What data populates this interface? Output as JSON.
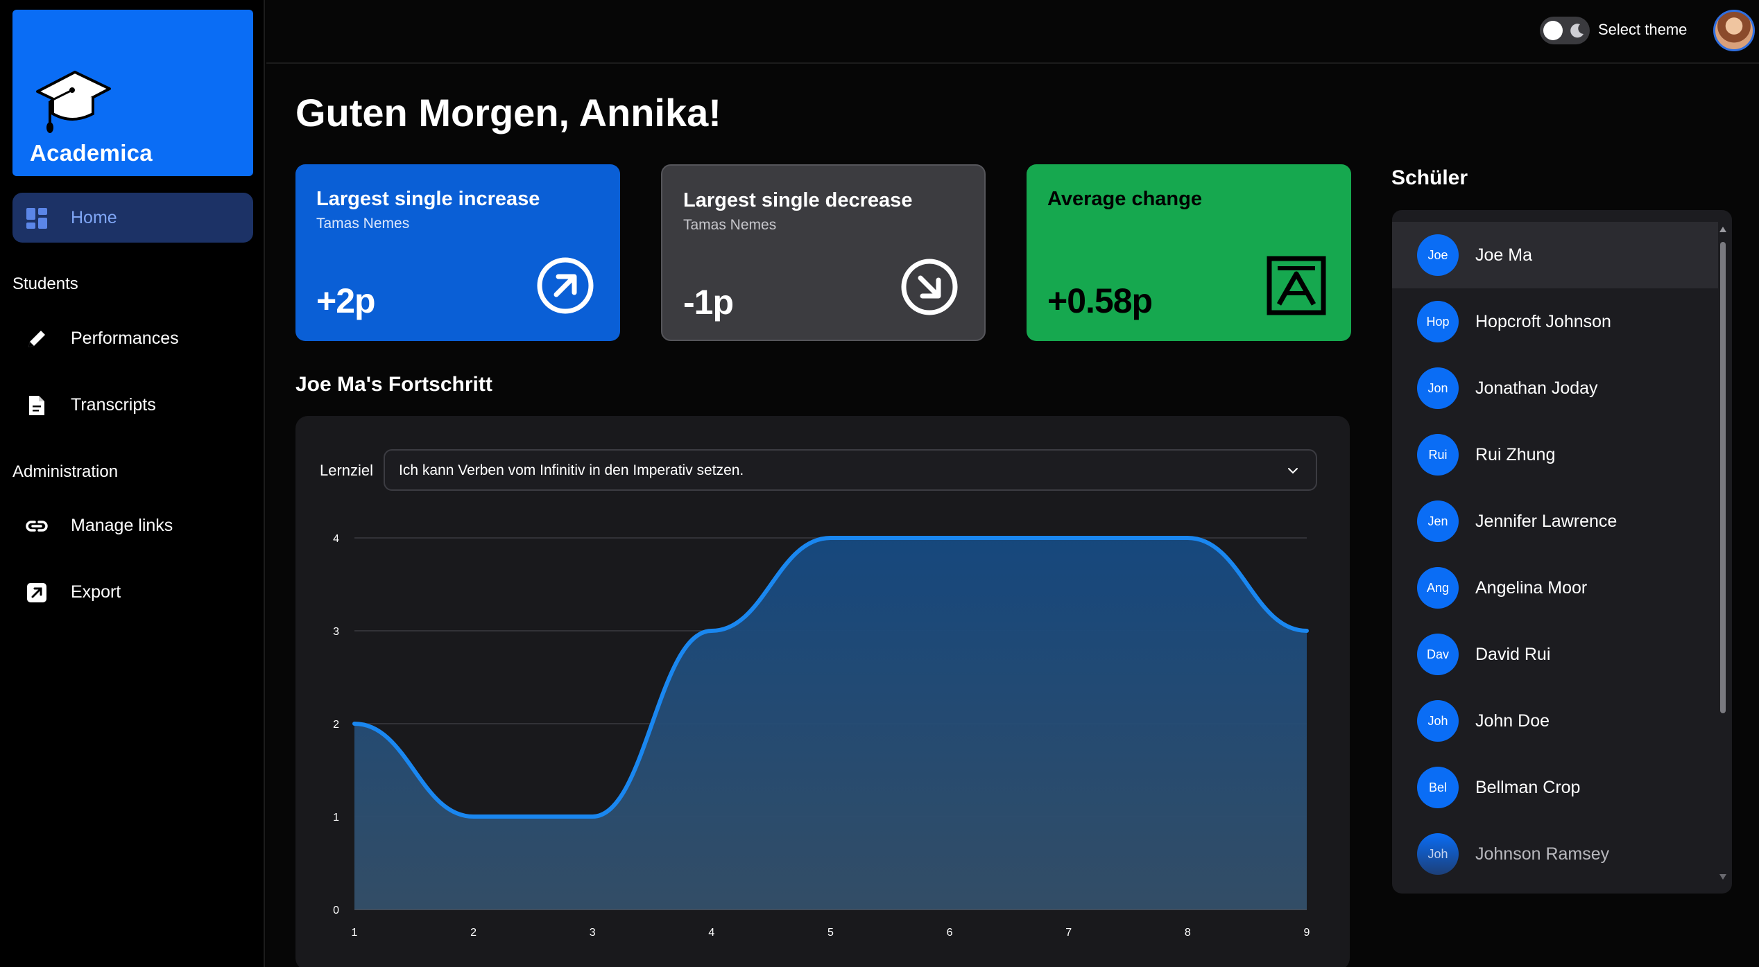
{
  "app": {
    "name": "Academica"
  },
  "sidebar": {
    "home": {
      "label": "Home"
    },
    "sections": [
      {
        "label": "Students",
        "items": [
          {
            "label": "Performances",
            "icon": "pencil-icon"
          },
          {
            "label": "Transcripts",
            "icon": "document-icon"
          }
        ]
      },
      {
        "label": "Administration",
        "items": [
          {
            "label": "Manage links",
            "icon": "link-icon"
          },
          {
            "label": "Export",
            "icon": "export-icon"
          }
        ]
      }
    ]
  },
  "topbar": {
    "theme_label": "Select theme"
  },
  "greeting": "Guten Morgen, Annika!",
  "cards": {
    "increase": {
      "title": "Largest single increase",
      "subtitle": "Tamas Nemes",
      "value": "+2p",
      "color": "#0a5fd6"
    },
    "decrease": {
      "title": "Largest single decrease",
      "subtitle": "Tamas Nemes",
      "value": "-1p",
      "color": "#3c3c40"
    },
    "average": {
      "title": "Average change",
      "value": "+0.58p",
      "color": "#16a84f"
    }
  },
  "progress": {
    "title": "Joe Ma's Fortschritt",
    "goal_label": "Lernziel",
    "goal_value": "Ich kann Verben vom Infinitiv in den Imperativ setzen."
  },
  "chart_data": {
    "type": "area",
    "x": [
      1,
      2,
      3,
      4,
      5,
      6,
      7,
      8,
      9
    ],
    "series": [
      {
        "values": [
          2,
          1,
          1,
          3,
          4,
          4,
          4,
          4,
          3
        ]
      }
    ],
    "ylim": [
      0,
      4
    ],
    "yticks": [
      0,
      1,
      2,
      3,
      4
    ],
    "xticks": [
      1,
      2,
      3,
      4,
      5,
      6,
      7,
      8,
      9
    ],
    "grid": true,
    "line_color": "#1a87f0",
    "fill_color": "#26517a"
  },
  "students": {
    "title": "Schüler",
    "list": [
      {
        "abbr": "Joe",
        "name": "Joe Ma"
      },
      {
        "abbr": "Hop",
        "name": "Hopcroft Johnson"
      },
      {
        "abbr": "Jon",
        "name": "Jonathan Joday"
      },
      {
        "abbr": "Rui",
        "name": "Rui Zhung"
      },
      {
        "abbr": "Jen",
        "name": "Jennifer Lawrence"
      },
      {
        "abbr": "Ang",
        "name": "Angelina Moor"
      },
      {
        "abbr": "Dav",
        "name": "David Rui"
      },
      {
        "abbr": "Joh",
        "name": "John Doe"
      },
      {
        "abbr": "Bel",
        "name": "Bellman Crop"
      },
      {
        "abbr": "Joh",
        "name": "Johnson Ramsey"
      }
    ]
  }
}
